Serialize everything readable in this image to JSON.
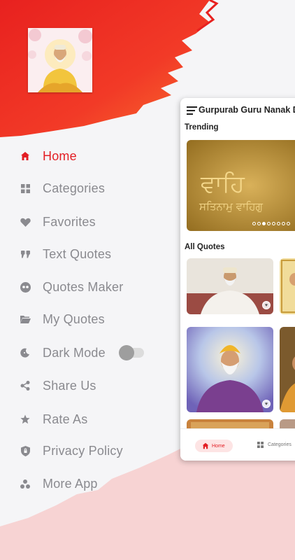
{
  "colors": {
    "accent": "#e31e24",
    "muted": "#8a8a8f",
    "top_splash": "#ea2525",
    "bottom_splash": "#f7d3d3"
  },
  "drawer": {
    "avatar_alt": "Guru Nanak Dev Ji",
    "menu": [
      {
        "label": "Home",
        "icon": "home-icon",
        "active": true
      },
      {
        "label": "Categories",
        "icon": "grid-icon"
      },
      {
        "label": "Favorites",
        "icon": "heart-icon"
      },
      {
        "label": "Text Quotes",
        "icon": "quote-icon"
      },
      {
        "label": "Quotes Maker",
        "icon": "quote-bubble-icon"
      },
      {
        "label": "My Quotes",
        "icon": "folder-icon"
      },
      {
        "label": "Dark Mode",
        "icon": "moon-icon",
        "toggle": false
      },
      {
        "label": "Share Us",
        "icon": "share-icon"
      },
      {
        "label": "Rate As",
        "icon": "star-icon"
      },
      {
        "label": "Privacy Policy",
        "icon": "shield-icon"
      },
      {
        "label": "More App",
        "icon": "apps-icon"
      }
    ]
  },
  "app": {
    "title": "Gurpurab Guru Nanak D",
    "trending_label": "Trending",
    "all_quotes_label": "All Quotes",
    "banner_text_1": "ਵਾਹਿ",
    "banner_text_2": "ਸਤਿਨਾਮੁ ਵਾਹਿਗੁ",
    "carousel": {
      "count": 8,
      "active_index": 2
    },
    "bottom_nav": {
      "home": "Home",
      "categories": "Categories"
    }
  }
}
